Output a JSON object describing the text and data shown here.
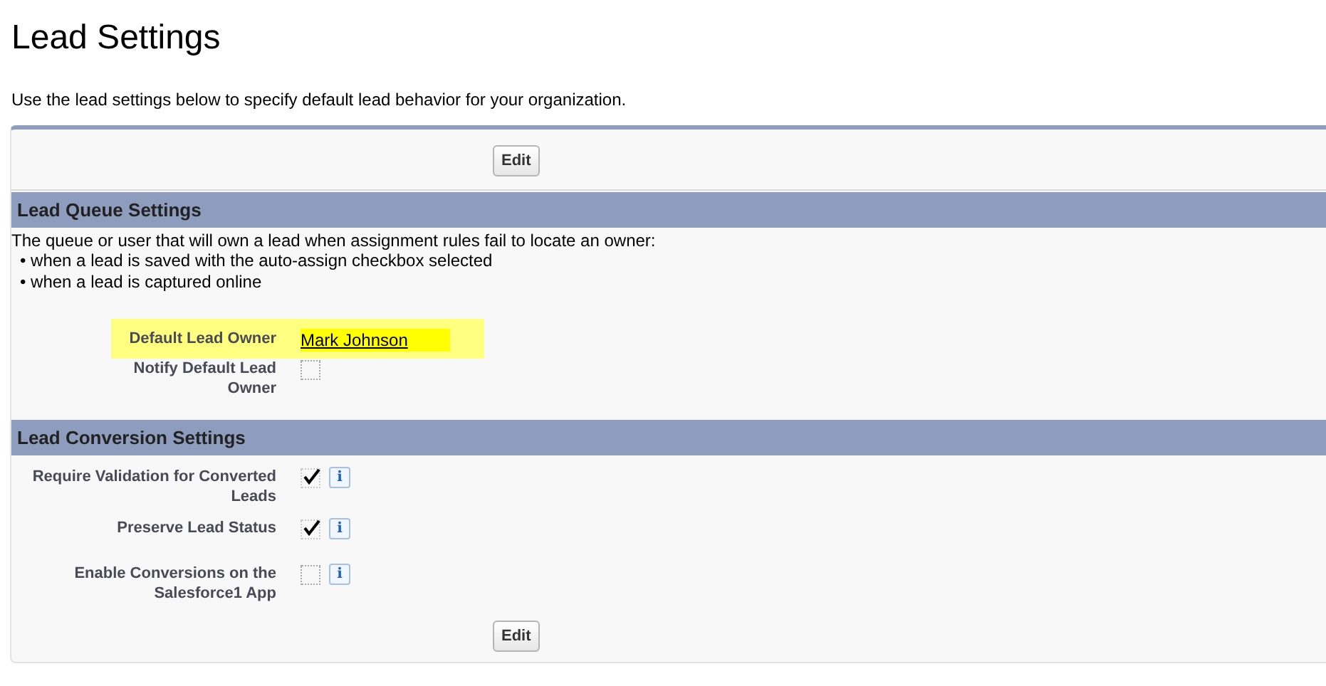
{
  "page": {
    "title": "Lead Settings",
    "description": "Use the lead settings below to specify default lead behavior for your organization."
  },
  "top_button": "Edit",
  "queue_section": {
    "title": "Lead Queue Settings",
    "intro": "The queue or user that will own a lead when assignment rules fail to locate an owner:",
    "bullets": [
      "• when a lead is saved with the auto-assign checkbox selected",
      "• when a lead is captured online"
    ],
    "fields": [
      {
        "kind": "link",
        "label": "Default Lead Owner",
        "value": "Mark Johnson",
        "highlighted": true
      },
      {
        "kind": "checkbox",
        "label": "Notify Default Lead Owner",
        "checked": false
      }
    ]
  },
  "conversion_section": {
    "title": "Lead Conversion Settings",
    "fields": [
      {
        "kind": "checkbox",
        "label": "Require Validation for Converted Leads",
        "checked": true,
        "info": "i"
      },
      {
        "kind": "checkbox",
        "label": "Preserve Lead Status",
        "checked": true,
        "info": "i"
      },
      {
        "kind": "checkbox",
        "label": "Enable Conversions on the Salesforce1 App",
        "checked": false,
        "info": "i"
      }
    ]
  },
  "bottom_button": "Edit"
}
